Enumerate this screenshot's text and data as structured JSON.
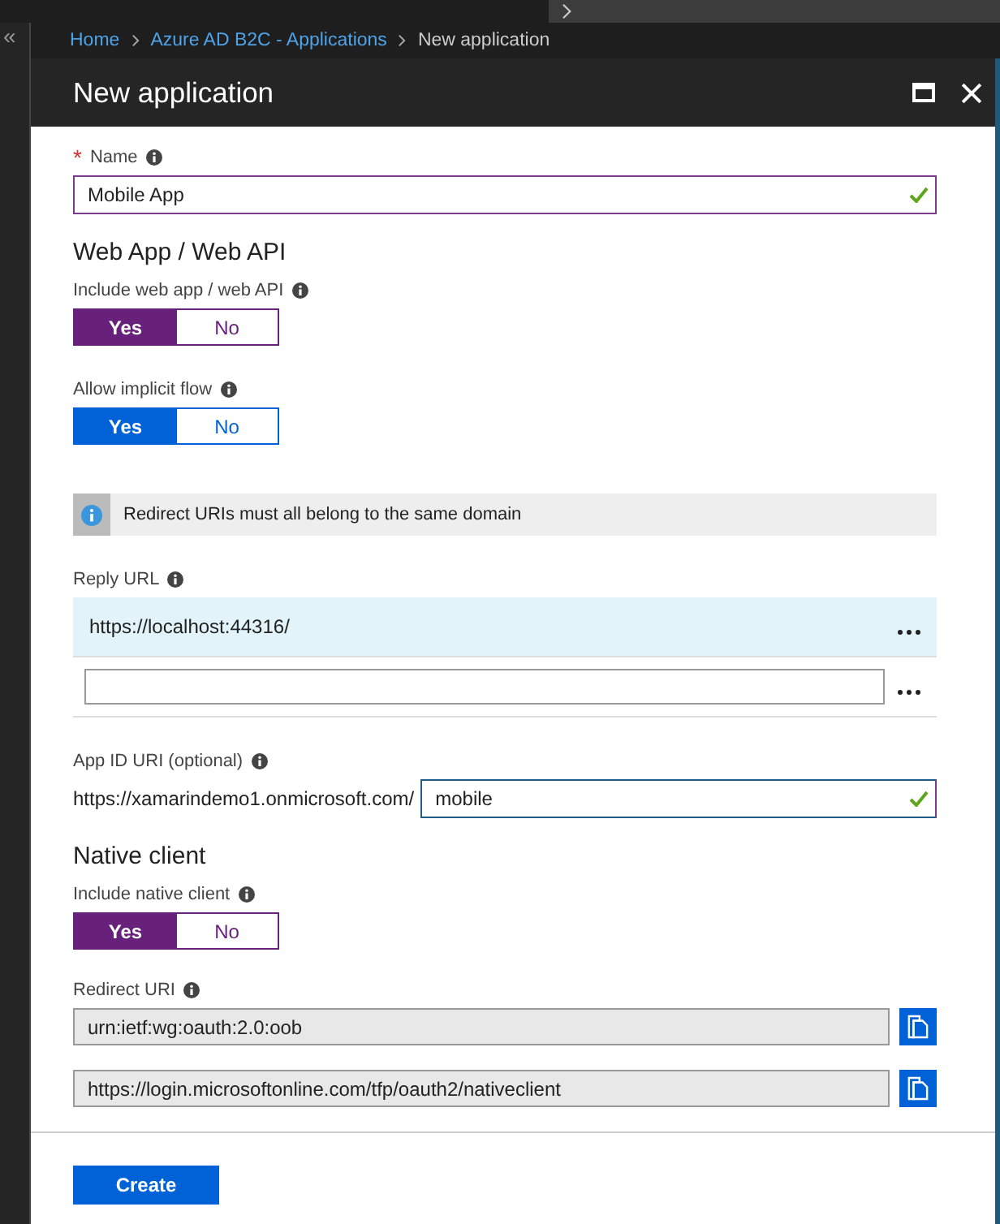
{
  "sidebar": {
    "collapse_glyph": "«"
  },
  "breadcrumb": [
    {
      "label": "Home",
      "link": true
    },
    {
      "label": "Azure AD B2C - Applications",
      "link": true
    },
    {
      "label": "New application",
      "link": false
    }
  ],
  "blade": {
    "title": "New application"
  },
  "name_field": {
    "label": "Name",
    "required_mark": "*",
    "value": "Mobile App",
    "valid": true
  },
  "web_section": {
    "heading": "Web App / Web API",
    "toggles": [
      {
        "label": "Include web app / web API",
        "focused": false,
        "options": [
          {
            "label": "Yes",
            "selected": true
          },
          {
            "label": "No",
            "selected": false
          }
        ]
      },
      {
        "label": "Allow implicit flow",
        "focused": true,
        "options": [
          {
            "label": "Yes",
            "selected": true
          },
          {
            "label": "No",
            "selected": false
          }
        ]
      }
    ],
    "info": "Redirect URIs must all belong to the same domain",
    "reply_url": {
      "label": "Reply URL",
      "rows": [
        {
          "value": "https://localhost:44316/",
          "selected": true
        },
        {
          "selected": false
        }
      ]
    },
    "app_id": {
      "label": "App ID URI (optional)",
      "prefix": "https://xamarindemo1.onmicrosoft.com/",
      "value": "mobile",
      "valid": true
    }
  },
  "native_section": {
    "heading": "Native client",
    "toggle": {
      "label": "Include native client",
      "focused": false,
      "options": [
        {
          "label": "Yes",
          "selected": true
        },
        {
          "label": "No",
          "selected": false
        }
      ]
    },
    "redirect": {
      "label": "Redirect URI",
      "values": [
        "urn:ietf:wg:oauth:2.0:oob",
        "https://login.microsoftonline.com/tfp/oauth2/nativeclient"
      ]
    }
  },
  "buttons": [
    "Create"
  ]
}
